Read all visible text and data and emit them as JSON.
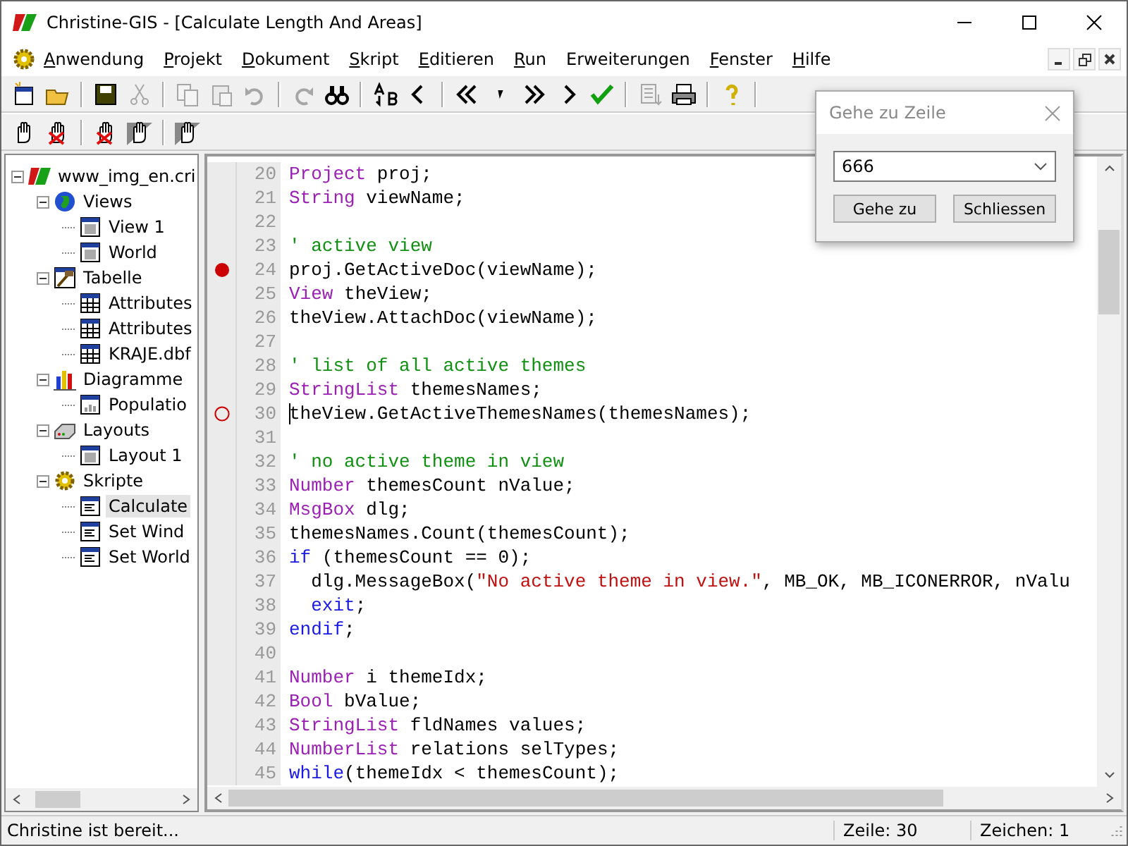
{
  "window": {
    "title": "Christine-GIS - [Calculate Length And Areas]"
  },
  "menu": [
    {
      "label": "Anwendung",
      "underline": true
    },
    {
      "label": "Projekt",
      "underline": true
    },
    {
      "label": "Dokument",
      "underline": true
    },
    {
      "label": "Skript",
      "underline": true
    },
    {
      "label": "Editieren",
      "underline": true
    },
    {
      "label": "Run",
      "underline": true
    },
    {
      "label": "Erweiterungen",
      "underline": false
    },
    {
      "label": "Fenster",
      "underline": true
    },
    {
      "label": "Hilfe",
      "underline": true
    }
  ],
  "toolbar": [
    {
      "disabled": false
    },
    {
      "disabled": false
    },
    {
      "disabled": false
    },
    {
      "disabled": true
    },
    {
      "disabled": true
    },
    {
      "disabled": true
    },
    {
      "disabled": true
    },
    {
      "disabled": true
    },
    {
      "disabled": false
    },
    {
      "disabled": false
    },
    {
      "disabled": false
    },
    {
      "disabled": false
    },
    {
      "disabled": false
    },
    {
      "disabled": false
    },
    {
      "disabled": false
    },
    {
      "disabled": false
    },
    {
      "disabled": true
    },
    {
      "disabled": false
    },
    {
      "disabled": false
    }
  ],
  "toolbar_2": [
    {
      "disabled": false
    },
    {
      "disabled": false
    },
    {
      "disabled": false
    },
    {
      "disabled": false
    },
    {
      "disabled": false
    }
  ],
  "tree": [
    {
      "label": "www_img_en.cri",
      "kind": "project",
      "expanded": true,
      "selected": false,
      "children": [
        {
          "label": "Views",
          "kind": "views",
          "expanded": true,
          "selected": false,
          "children": [
            {
              "label": "View 1",
              "kind": "view",
              "selected": false
            },
            {
              "label": "World",
              "kind": "view",
              "selected": false
            }
          ]
        },
        {
          "label": "Tabelle",
          "kind": "tables",
          "expanded": true,
          "selected": false,
          "children": [
            {
              "label": "Attributes",
              "kind": "table",
              "selected": false
            },
            {
              "label": "Attributes",
              "kind": "table",
              "selected": false
            },
            {
              "label": "KRAJE.dbf",
              "kind": "table",
              "selected": false
            }
          ]
        },
        {
          "label": "Diagramme",
          "kind": "charts",
          "expanded": true,
          "selected": false,
          "children": [
            {
              "label": "Populatio",
              "kind": "chart",
              "selected": false
            }
          ]
        },
        {
          "label": "Layouts",
          "kind": "layouts",
          "expanded": true,
          "selected": false,
          "children": [
            {
              "label": "Layout 1",
              "kind": "layout",
              "selected": false
            }
          ]
        },
        {
          "label": "Skripte",
          "kind": "scripts",
          "expanded": true,
          "selected": false,
          "children": [
            {
              "label": "Calculate",
              "kind": "script",
              "selected": true
            },
            {
              "label": "Set Wind",
              "kind": "script",
              "selected": false
            },
            {
              "label": "Set World",
              "kind": "script",
              "selected": false
            }
          ]
        }
      ]
    }
  ],
  "editor": {
    "lines": [
      {
        "number": "20",
        "breakpoint": false,
        "tokens": [
          {
            "kind": "keyword",
            "text": "Project"
          },
          {
            "kind": "plain",
            "text": " proj;"
          }
        ]
      },
      {
        "number": "21",
        "breakpoint": false,
        "tokens": [
          {
            "kind": "keyword",
            "text": "String"
          },
          {
            "kind": "plain",
            "text": " viewName;"
          }
        ]
      },
      {
        "number": "22",
        "breakpoint": false
      },
      {
        "number": "23",
        "breakpoint": false,
        "tokens": [
          {
            "kind": "comment",
            "text": "' active view"
          }
        ]
      },
      {
        "number": "24",
        "breakpoint": true,
        "enabled": true,
        "tokens": [
          {
            "kind": "plain",
            "text": "proj.GetActiveDoc(viewName);"
          }
        ]
      },
      {
        "number": "25",
        "breakpoint": false,
        "tokens": [
          {
            "kind": "keyword",
            "text": "View"
          },
          {
            "kind": "plain",
            "text": " theView;"
          }
        ]
      },
      {
        "number": "26",
        "breakpoint": false,
        "tokens": [
          {
            "kind": "plain",
            "text": "theView.AttachDoc(viewName);"
          }
        ]
      },
      {
        "number": "27",
        "breakpoint": false
      },
      {
        "number": "28",
        "breakpoint": false,
        "tokens": [
          {
            "kind": "comment",
            "text": "' list of all active themes"
          }
        ]
      },
      {
        "number": "29",
        "breakpoint": false,
        "tokens": [
          {
            "kind": "keyword",
            "text": "StringList"
          },
          {
            "kind": "plain",
            "text": " themesNames;"
          }
        ]
      },
      {
        "number": "30",
        "breakpoint": true,
        "enabled": false,
        "caret": true,
        "tokens": [
          {
            "kind": "plain",
            "text": "theView.GetActiveThemesNames(themesNames);"
          }
        ]
      },
      {
        "number": "31",
        "breakpoint": false
      },
      {
        "number": "32",
        "breakpoint": false,
        "tokens": [
          {
            "kind": "comment",
            "text": "' no active theme in view"
          }
        ]
      },
      {
        "number": "33",
        "breakpoint": false,
        "tokens": [
          {
            "kind": "keyword",
            "text": "Number"
          },
          {
            "kind": "plain",
            "text": " themesCount nValue;"
          }
        ]
      },
      {
        "number": "34",
        "breakpoint": false,
        "tokens": [
          {
            "kind": "keyword",
            "text": "MsgBox"
          },
          {
            "kind": "plain",
            "text": " dlg;"
          }
        ]
      },
      {
        "number": "35",
        "breakpoint": false,
        "tokens": [
          {
            "kind": "plain",
            "text": "themesNames.Count(themesCount);"
          }
        ]
      },
      {
        "number": "36",
        "breakpoint": false,
        "tokens": [
          {
            "kind": "control",
            "text": "if"
          },
          {
            "kind": "plain",
            "text": " (themesCount == 0);"
          }
        ]
      },
      {
        "number": "37",
        "breakpoint": false,
        "tokens": [
          {
            "kind": "plain",
            "text": "  dlg.MessageBox("
          },
          {
            "kind": "string",
            "text": "\"No active theme in view.\""
          },
          {
            "kind": "plain",
            "text": ", MB_OK, MB_ICONERROR, nValu"
          }
        ]
      },
      {
        "number": "38",
        "breakpoint": false,
        "tokens": [
          {
            "kind": "control",
            "text": "  exit"
          },
          {
            "kind": "plain",
            "text": ";"
          }
        ]
      },
      {
        "number": "39",
        "breakpoint": false,
        "tokens": [
          {
            "kind": "control",
            "text": "endif"
          },
          {
            "kind": "plain",
            "text": ";"
          }
        ]
      },
      {
        "number": "40",
        "breakpoint": false
      },
      {
        "number": "41",
        "breakpoint": false,
        "tokens": [
          {
            "kind": "keyword",
            "text": "Number"
          },
          {
            "kind": "plain",
            "text": " i themeIdx;"
          }
        ]
      },
      {
        "number": "42",
        "breakpoint": false,
        "tokens": [
          {
            "kind": "keyword",
            "text": "Bool"
          },
          {
            "kind": "plain",
            "text": " bValue;"
          }
        ]
      },
      {
        "number": "43",
        "breakpoint": false,
        "tokens": [
          {
            "kind": "keyword",
            "text": "StringList"
          },
          {
            "kind": "plain",
            "text": " fldNames values;"
          }
        ]
      },
      {
        "number": "44",
        "breakpoint": false,
        "tokens": [
          {
            "kind": "keyword",
            "text": "NumberList"
          },
          {
            "kind": "plain",
            "text": " relations selTypes;"
          }
        ]
      },
      {
        "number": "45",
        "breakpoint": false,
        "tokens": [
          {
            "kind": "control",
            "text": "while"
          },
          {
            "kind": "plain",
            "text": "(themeIdx < themesCount);"
          }
        ]
      }
    ]
  },
  "dialog": {
    "title": "Gehe zu Zeile",
    "value": "666",
    "buttons": [
      "Gehe zu",
      "Schliessen"
    ]
  },
  "status_bar": {
    "message": "Christine ist bereit...",
    "line": "Zeile: 30",
    "column": "Zeichen: 1"
  }
}
